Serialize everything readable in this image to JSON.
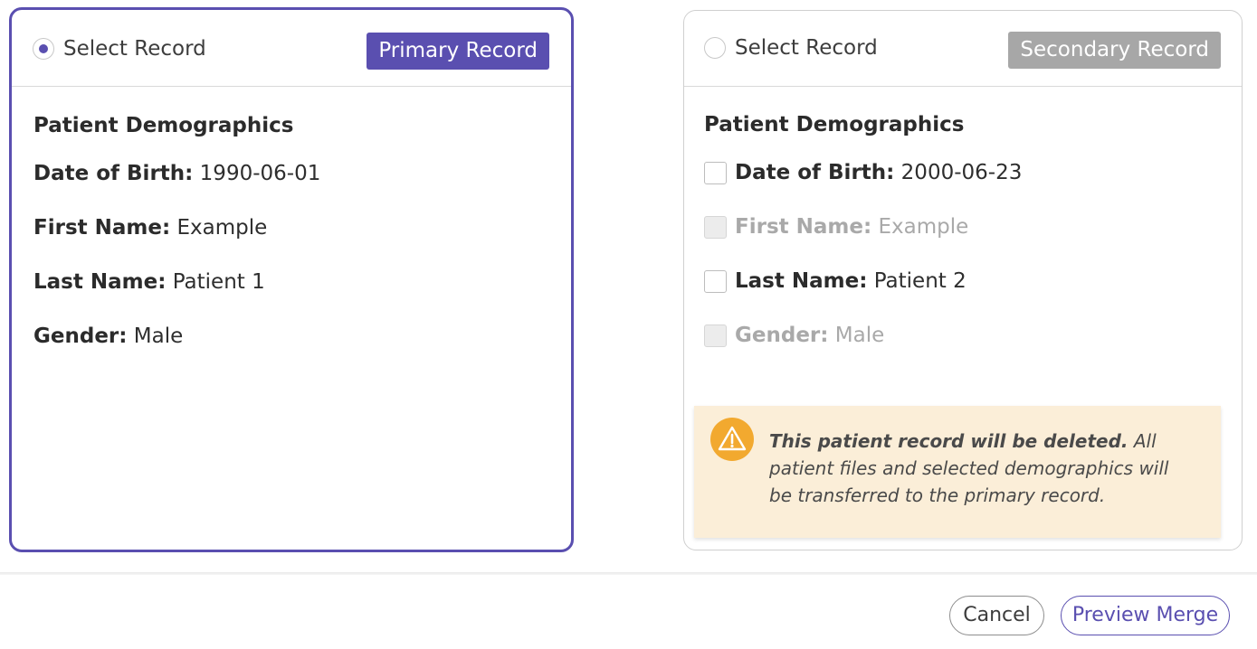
{
  "primary": {
    "select_label": "Select Record",
    "selected": true,
    "badge": "Primary Record",
    "section_title": "Patient Demographics",
    "fields": [
      {
        "label": "Date of Birth:",
        "value": "1990-06-01"
      },
      {
        "label": "First Name:",
        "value": "Example"
      },
      {
        "label": "Last Name:",
        "value": "Patient 1"
      },
      {
        "label": "Gender:",
        "value": "Male"
      }
    ]
  },
  "secondary": {
    "select_label": "Select Record",
    "selected": false,
    "badge": "Secondary Record",
    "section_title": "Patient Demographics",
    "fields": [
      {
        "label": "Date of Birth:",
        "value": "2000-06-23",
        "checked": false,
        "disabled": false
      },
      {
        "label": "First Name:",
        "value": "Example",
        "checked": false,
        "disabled": true
      },
      {
        "label": "Last Name:",
        "value": "Patient 2",
        "checked": false,
        "disabled": false
      },
      {
        "label": "Gender:",
        "value": "Male",
        "checked": false,
        "disabled": true
      }
    ],
    "warning": {
      "icon": "warning-triangle-icon",
      "bold_text": "This patient record will be deleted.",
      "text": " All patient files and selected demographics will be transferred to the primary record."
    }
  },
  "footer": {
    "cancel_label": "Cancel",
    "preview_label": "Preview Merge"
  },
  "colors": {
    "accent": "#5a4fb0",
    "secondary_badge": "#a7a7a7",
    "warning_bg": "#fbeed8",
    "warning_icon": "#f2a92f"
  }
}
